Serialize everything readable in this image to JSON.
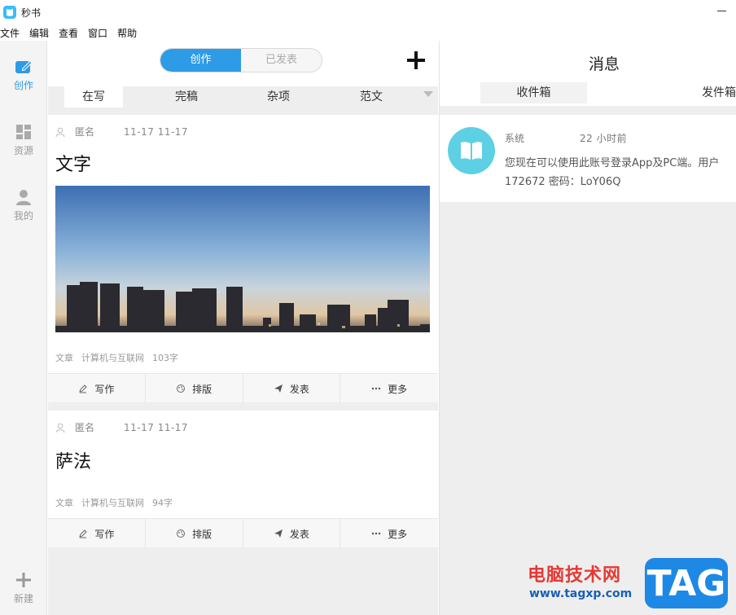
{
  "app": {
    "title": "秒书"
  },
  "menu": [
    "文件",
    "编辑",
    "查看",
    "窗口",
    "帮助"
  ],
  "nav": {
    "create": "创作",
    "resources": "资源",
    "mine": "我的",
    "new": "新建"
  },
  "segment": {
    "create": "创作",
    "published": "已发表"
  },
  "tabs": [
    "在写",
    "完稿",
    "杂项",
    "范文"
  ],
  "cards": [
    {
      "author": "匿名",
      "dates": "11-17   11-17",
      "title": "文字",
      "type": "文章",
      "category": "计算机与互联网",
      "words": "103字"
    },
    {
      "author": "匿名",
      "dates": "11-17   11-17",
      "title": "萨法",
      "type": "文章",
      "category": "计算机与互联网",
      "words": "94字"
    }
  ],
  "actions": {
    "write": "写作",
    "layout": "排版",
    "publish": "发表",
    "more": "更多"
  },
  "messages": {
    "title": "消息",
    "inbox": "收件箱",
    "outbox": "发件箱",
    "item": {
      "sender": "系统",
      "time": "22 小时前",
      "line1": "您现在可以使用此账号登录App及PC端。用户",
      "line2": "172672 密码：LoY06Q"
    }
  },
  "watermark": {
    "text": "电脑技术网",
    "url": "www.tagxp.com",
    "tag": "TAG"
  },
  "colors": {
    "accent": "#2e9be6",
    "avatar": "#5ed0e4"
  }
}
